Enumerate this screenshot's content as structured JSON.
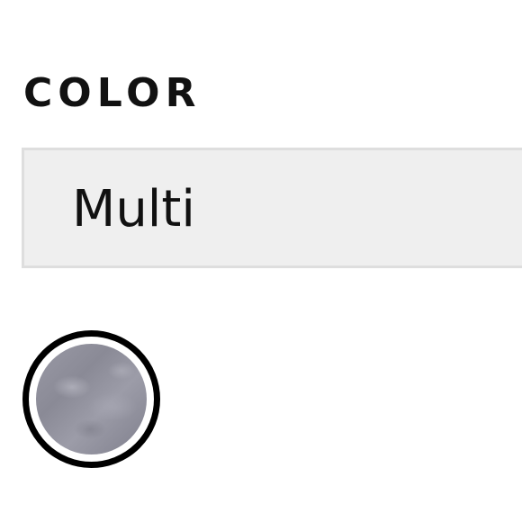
{
  "color_option": {
    "heading": "COLOR",
    "selected_value": "Multi",
    "swatches": [
      {
        "name": "Multi",
        "selected": true,
        "icon": "marbled-gray-swatch"
      }
    ]
  },
  "colors": {
    "heading_text": "#111111",
    "selected_box_bg": "#efefef",
    "selected_box_border": "#dedede",
    "swatch_ring": "#000000",
    "swatch_fill": "#8f8f9b"
  }
}
